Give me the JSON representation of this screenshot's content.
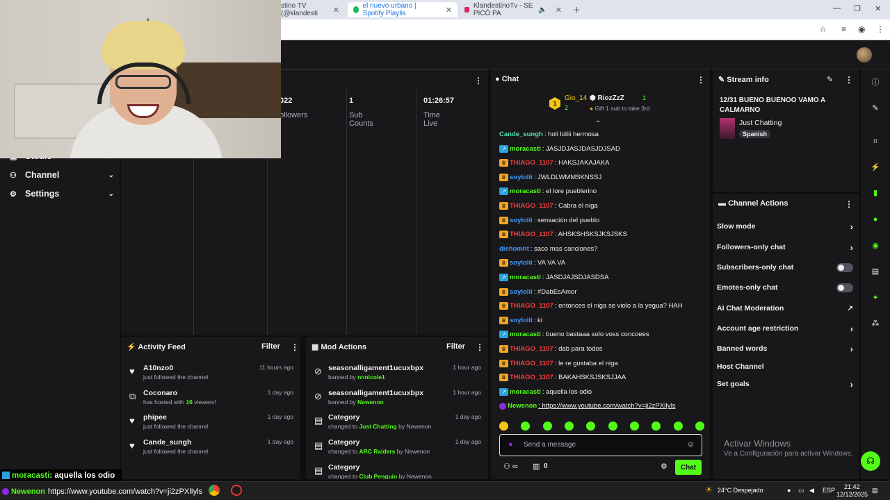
{
  "browser": {
    "tabs": [
      {
        "label": "stino TV (@klandesti"
      },
      {
        "label": "el nuevo urbano | Spotify Playlis"
      },
      {
        "label": "KlandestinoTv - SE PICÓ PA"
      }
    ]
  },
  "nav": {
    "items": [
      {
        "label": "Studio"
      },
      {
        "label": "Channel"
      },
      {
        "label": "Settings"
      }
    ]
  },
  "stats": [
    {
      "value": "022",
      "label": "ollowers"
    },
    {
      "value": "1",
      "label": "Sub Counts"
    },
    {
      "value": "01:26:57",
      "label": "Time Live"
    }
  ],
  "activity_feed": {
    "title": "Activity Feed",
    "filter": "Filter",
    "items": [
      {
        "icon": "heart-icon",
        "name": "A10nzo0",
        "sub": "just followed the channel",
        "time": "11 hours ago"
      },
      {
        "icon": "host-icon",
        "name": "Coconaro",
        "sub_pre": "has hosted with ",
        "sub_num": "16",
        "sub_post": " viewers!",
        "time": "1 day ago"
      },
      {
        "icon": "heart-icon",
        "name": "phipee",
        "sub": "just followed the channel",
        "time": "1 day ago"
      },
      {
        "icon": "heart-icon",
        "name": "Cande_sungh",
        "sub": "just followed the channel",
        "time": "1 day ago"
      }
    ]
  },
  "mod_actions": {
    "title": "Mod Actions",
    "filter": "Filter",
    "items": [
      {
        "icon": "ban-icon",
        "name": "seasonalligament1ucuxbpx",
        "pre": "banned by ",
        "who": "nnnicole1",
        "post": "",
        "time": "1 hour ago"
      },
      {
        "icon": "ban-icon",
        "name": "seasonalligament1ucuxbpx",
        "pre": "banned by ",
        "who": "Newenon",
        "post": "",
        "time": "1 hour ago"
      },
      {
        "icon": "category-icon",
        "name": "Category",
        "pre": "changed to ",
        "who": "Just Chatting",
        "post": " by Newenon",
        "time": "1 day ago"
      },
      {
        "icon": "category-icon",
        "name": "Category",
        "pre": "changed to ",
        "who": "ARC Raiders",
        "post": " by Newenon",
        "time": "1 day ago"
      },
      {
        "icon": "category-icon",
        "name": "Category",
        "pre": "changed to ",
        "who": "Club Penguin",
        "post": " by Newenon",
        "time": ""
      }
    ]
  },
  "chat": {
    "title": "Chat",
    "leaderboard": {
      "first_name": "Gio_14",
      "first_count": "2",
      "second_name": "RiozZzZ",
      "second_count": "1",
      "gift_text": "Gift 1 sub to take 3rd"
    },
    "messages": [
      {
        "badge": "",
        "user": "Cande_sungh",
        "color": "u-cyan",
        "text": ": holi loliii hermosa"
      },
      {
        "badge": "sub",
        "user": "moracasti",
        "color": "u-green",
        "text": ": JASJDJASJDASJDJSAD"
      },
      {
        "badge": "crown",
        "user": "THIAGO_1107",
        "color": "u-red",
        "text": ": HAKSJAKAJAKA"
      },
      {
        "badge": "crown",
        "user": "soylolii",
        "color": "u-blue",
        "text": ": JWLDLWMMSKNSSJ"
      },
      {
        "badge": "sub",
        "user": "moracasti",
        "color": "u-green",
        "text": ": el lore pueblerino"
      },
      {
        "badge": "crown",
        "user": "THIAGO_1107",
        "color": "u-red",
        "text": ": Cabra el niga"
      },
      {
        "badge": "crown",
        "user": "soylolii",
        "color": "u-blue",
        "text": ": sensación del pueblo"
      },
      {
        "badge": "crown",
        "user": "THIAGO_1107",
        "color": "u-red",
        "text": ": AHSKSHSKSJKSJSKS"
      },
      {
        "badge": "",
        "user": "diehomht",
        "color": "u-blue",
        "text": ": saco mas canciones?"
      },
      {
        "badge": "crown",
        "user": "soylolii",
        "color": "u-blue",
        "text": ": VA VA VA"
      },
      {
        "badge": "sub",
        "user": "moracasti",
        "color": "u-green",
        "text": ": JASDJAJSDJASDSA"
      },
      {
        "badge": "crown",
        "user": "soylolii",
        "color": "u-blue",
        "text": ": #DabEsAmor"
      },
      {
        "badge": "crown",
        "user": "THIAGO_1107",
        "color": "u-red",
        "text": ": entonces el niga se violo a la yegua? HAH"
      },
      {
        "badge": "crown",
        "user": "soylolii",
        "color": "u-blue",
        "text": ": ki"
      },
      {
        "badge": "sub",
        "user": "moracasti",
        "color": "u-green",
        "text": ": bueno bastaaa solo voss concoees"
      },
      {
        "badge": "crown",
        "user": "THIAGO_1107",
        "color": "u-red",
        "text": ": dab para todos"
      },
      {
        "badge": "crown",
        "user": "THIAGO_1107",
        "color": "u-red",
        "text": ": le re gustaba el niga"
      },
      {
        "badge": "crown",
        "user": "THIAGO_1107",
        "color": "u-red",
        "text": ": BAKAHSKSJSKSJJAA"
      },
      {
        "badge": "sub",
        "user": "moracasti",
        "color": "u-green",
        "text": ": aquella los odio"
      },
      {
        "badge": "mic",
        "user": "Newenon",
        "color": "u-green",
        "text": ": https://www.youtube.com/watch?v=ji2zPXlIyls"
      }
    ],
    "input_placeholder": "Send a message",
    "points": "0",
    "send_label": "Chat"
  },
  "stream_info": {
    "title": "Stream info",
    "stream_title": "12/31 BUENO BUENOO VAMO A CALMARNO",
    "category": "Just Chatting",
    "language": "Spanish"
  },
  "channel_actions": {
    "title": "Channel Actions",
    "items": [
      {
        "label": "Slow mode",
        "type": "arrow"
      },
      {
        "label": "Followers-only chat",
        "type": "arrow"
      },
      {
        "label": "Subscribers-only chat",
        "type": "toggle"
      },
      {
        "label": "Emotes-only chat",
        "type": "toggle"
      },
      {
        "label": "AI Chat Moderation",
        "type": "external"
      },
      {
        "label": "Account age restriction",
        "type": "arrow"
      },
      {
        "label": "Banned words",
        "type": "arrow"
      },
      {
        "label": "Host Channel",
        "type": "none"
      },
      {
        "label": "Set goals",
        "type": "arrow"
      }
    ]
  },
  "windows_watermark": {
    "title": "Activar Windows",
    "subtitle": "Ve a Configuración para activar Windows."
  },
  "overlay": {
    "message_user": "moracasti",
    "message_text": " : aquella los odio",
    "url_user": "Newenon",
    "url_text": "https://www.youtube.com/watch?v=ji2zPXlIyls"
  },
  "taskbar": {
    "weather": "24°C  Despejado",
    "lang": "ESP",
    "time": "21:42",
    "date": "12/12/2025"
  },
  "colors": {
    "accent": "#53fc18",
    "bg": "#0e0e10",
    "panel": "#18181b"
  }
}
